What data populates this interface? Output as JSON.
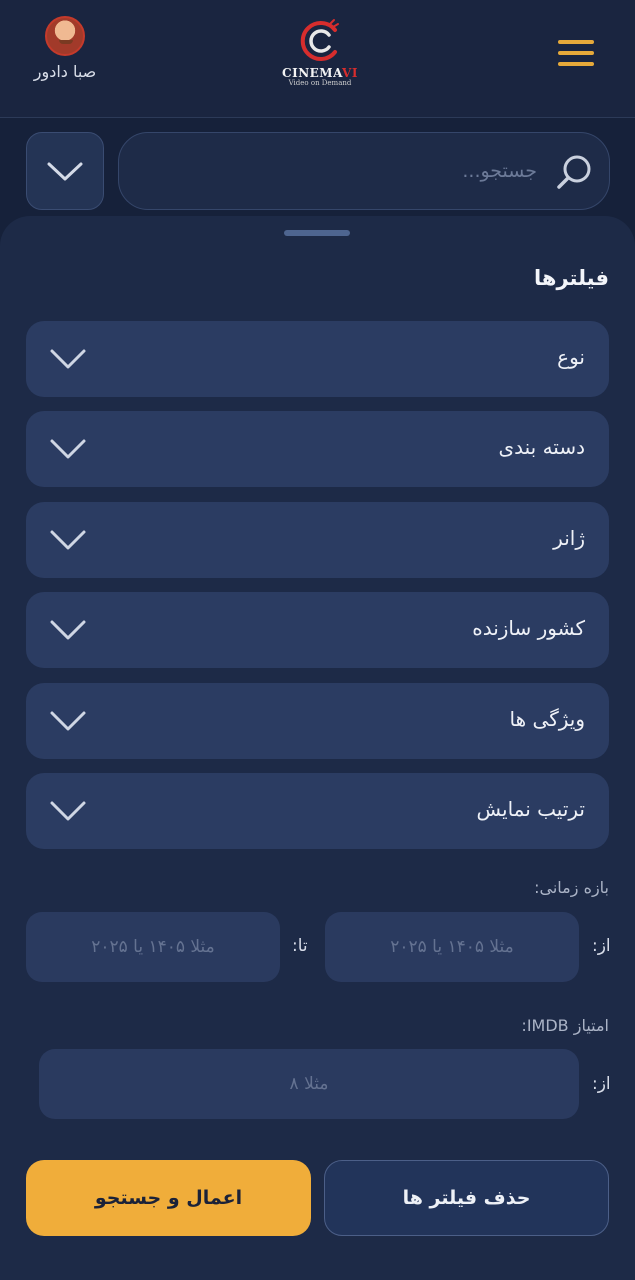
{
  "header": {
    "brand_main": "CINEMA",
    "brand_accent": "VI",
    "tagline": "Video on Demand",
    "user_name": "صبا دادور",
    "menu_icon": "hamburger-icon"
  },
  "search": {
    "placeholder": "جستجو..."
  },
  "filters": {
    "title": "فیلترها",
    "items": [
      {
        "label": "نوع"
      },
      {
        "label": "دسته بندی"
      },
      {
        "label": "ژانر"
      },
      {
        "label": "کشور سازنده"
      },
      {
        "label": "ویژگی ها"
      },
      {
        "label": "ترتیب نمایش"
      }
    ]
  },
  "date_range": {
    "label": "بازه زمانی:",
    "from_label": "از:",
    "to_label": "تا:",
    "from_placeholder": "مثلا ۱۴۰۵ یا ۲۰۲۵",
    "to_placeholder": "مثلا ۱۴۰۵ یا ۲۰۲۵"
  },
  "imdb": {
    "label": "امتیاز IMDB:",
    "from_label": "از:",
    "placeholder": "مثلا ۸"
  },
  "actions": {
    "clear_label": "حذف فیلتر ها",
    "apply_label": "اعمال و جستجو"
  },
  "colors": {
    "accent": "#f0ad3a",
    "brand_red": "#d72d2d",
    "background": "#16213a",
    "panel": "#1d2a47"
  }
}
